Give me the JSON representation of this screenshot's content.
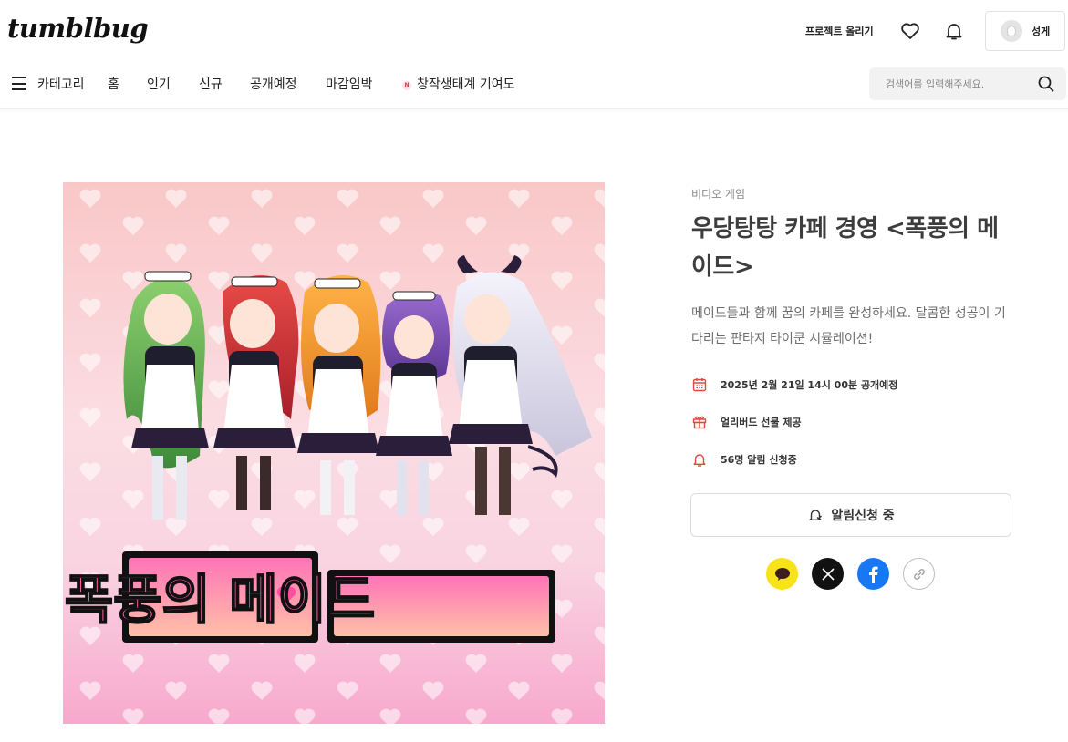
{
  "header": {
    "logo": "tumblbug",
    "project_upload": "프로젝트 올리기",
    "profile_name": "성게"
  },
  "nav": {
    "category": "카테고리",
    "items": [
      "홈",
      "인기",
      "신규",
      "공개예정",
      "마감임박"
    ],
    "badge_item": "창작생태계 기여도",
    "badge_letter": "N",
    "search_placeholder": "검색어를 입력해주세요."
  },
  "project": {
    "category": "비디오 게임",
    "title": "우당탕탕 카페 경영 <폭풍의 메이드>",
    "description": "메이드들과 함께 꿈의 카페를 완성하세요. 달콤한 성공이 기다리는 판타지 타이쿤 시뮬레이션!",
    "info": {
      "release": "2025년 2월 21일 14시 00분 공개예정",
      "gift": "얼리버드 선물 제공",
      "alerts": "56명 알림 신청중"
    },
    "notify_button": "알림신청 중",
    "hero_logo_text": "폭풍의 메이드"
  },
  "icons": {
    "menu": "menu-icon",
    "heart": "heart-icon",
    "bell": "bell-icon",
    "search": "search-icon",
    "calendar": "calendar-icon",
    "gift": "gift-icon",
    "share": [
      "kakaotalk-icon",
      "x-icon",
      "facebook-icon",
      "link-icon"
    ]
  },
  "colors": {
    "accent": "#e2483d",
    "kakao": "#f7e317",
    "x": "#111111",
    "facebook": "#1877f2"
  }
}
